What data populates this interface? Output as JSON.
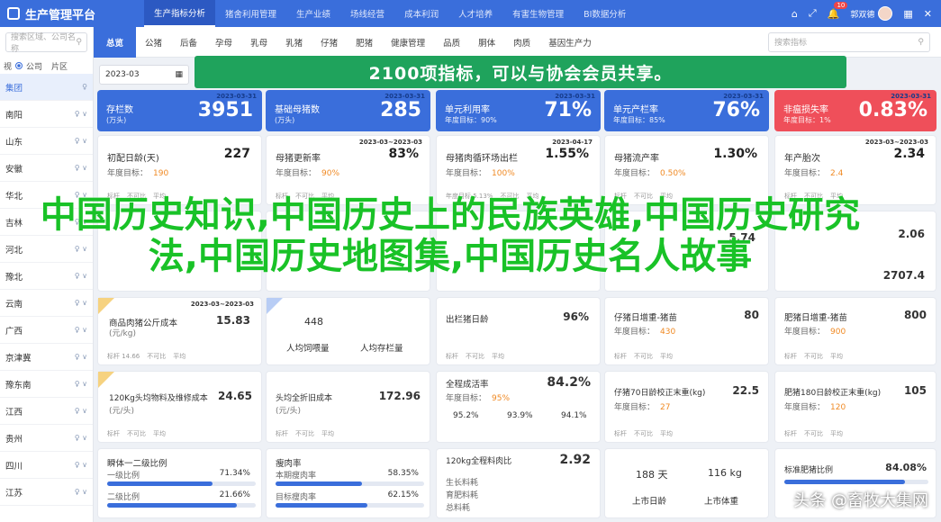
{
  "app": {
    "title": "生产管理平台",
    "user": "郭双德",
    "badge": "10"
  },
  "top_tabs": [
    "生产指标分析",
    "猪舍利用管理",
    "生产业绩",
    "场线经营",
    "成本利润",
    "人才培养",
    "有害生物管理",
    "BI数据分析"
  ],
  "sidebar": {
    "search_placeholder": "搜索区域、公司名称",
    "radio": [
      "公司",
      "片区"
    ],
    "items": [
      "集团",
      "南阳",
      "山东",
      "安徽",
      "华北",
      "吉林",
      "河北",
      "豫北",
      "云南",
      "广西",
      "京津冀",
      "豫东南",
      "江西",
      "贵州",
      "四川",
      "江苏"
    ]
  },
  "sub_tabs": [
    "总览",
    "公猪",
    "后备",
    "孕母",
    "乳母",
    "乳猪",
    "仔猪",
    "肥猪",
    "健康管理",
    "品质",
    "胴体",
    "肉质",
    "基因生产力"
  ],
  "sub_search": "搜索指标",
  "date": "2023-03",
  "banner": "2100项指标，可以与协会会员共享。",
  "kpis": [
    {
      "date": "2023-03-31",
      "title": "存栏数",
      "sub": "(万头)",
      "value": "3951",
      "color": "#3a6edb"
    },
    {
      "date": "2023-03-31",
      "title": "基础母猪数",
      "sub": "(万头)",
      "value": "285",
      "color": "#3a6edb"
    },
    {
      "date": "2023-03-31",
      "title": "单元利用率",
      "sub": "年度目标：90%",
      "value": "71%",
      "color": "#3a6edb"
    },
    {
      "date": "2023-03-31",
      "title": "单元产栏率",
      "sub": "年度目标：85%",
      "value": "76%",
      "color": "#3a6edb"
    },
    {
      "date": "2023-03-31",
      "title": "非瘟损失率",
      "sub": "年度目标：1%",
      "value": "0.83%",
      "color": "#ef4f5a"
    }
  ],
  "row2": [
    {
      "title": "初配日龄(天)",
      "value": "227",
      "goal": "190",
      "date": "",
      "foot": [
        "标杆",
        "不可比",
        "平均"
      ]
    },
    {
      "title": "母猪更新率",
      "value": "83%",
      "goal": "90%",
      "date": "2023-03~2023-03",
      "foot": [
        "标杆",
        "不可比",
        "平均"
      ]
    },
    {
      "title": "母猪肉循环场出栏",
      "value": "1.55%",
      "goal": "100%",
      "date": "2023-04-17",
      "foot": [
        "年度目标 5.13%",
        "不可比",
        "平均"
      ]
    },
    {
      "title": "母猪流产率",
      "value": "1.30%",
      "goal": "0.50%",
      "date": "",
      "foot": [
        "标杆",
        "不可比",
        "平均"
      ]
    },
    {
      "title": "年产胎次",
      "value": "2.34",
      "goal": "2.4",
      "date": "2023-03~2023-03",
      "foot": [
        "标杆",
        "不可比",
        "平均"
      ]
    }
  ],
  "row3": {
    "right1": "5.74",
    "right2": "2.06",
    "right3": "2707.4"
  },
  "row4": [
    {
      "date": "2023-03~2023-03",
      "title": "商品肉猪公斤成本",
      "sub": "(元/kg)",
      "value": "15.83",
      "foot": [
        "标杆 14.66",
        "不可比",
        "平均"
      ]
    },
    {
      "date": "",
      "title": "人均饲喂量",
      "value": "448",
      "title2": "人均存栏量",
      "value2": "",
      "foot": []
    },
    {
      "date": "",
      "title": "出栏猪日龄",
      "value": "96%",
      "foot": [
        "标杆",
        "不可比",
        "平均"
      ]
    },
    {
      "title": "仔猪日增重-猪苗",
      "value": "80",
      "goal": "430",
      "foot": [
        "标杆",
        "不可比",
        "平均"
      ]
    },
    {
      "title": "肥猪日增重-猪苗",
      "value": "800",
      "goal": "900",
      "foot": [
        "标杆",
        "不可比",
        "平均"
      ]
    }
  ],
  "row5": [
    {
      "title": "120Kg头均物料及维修成本",
      "sub": "(元/头)",
      "value": "24.65",
      "foot": [
        "标杆",
        "不可比",
        "平均"
      ]
    },
    {
      "title": "头均全折旧成本",
      "sub": "(元/头)",
      "value": "172.96",
      "foot": [
        "标杆",
        "不可比",
        "平均"
      ]
    },
    {
      "title": "全程成活率",
      "value": "84.2%",
      "goal": "95%",
      "rates": [
        "95.2%",
        "93.9%",
        "94.1%"
      ]
    },
    {
      "title": "仔猪70日龄校正末重(kg)",
      "value": "22.5",
      "goal": "27",
      "foot": [
        "标杆",
        "不可比",
        "平均"
      ]
    },
    {
      "title": "肥猪180日龄校正末重(kg)",
      "value": "105",
      "goal": "120",
      "foot": [
        "标杆",
        "不可比",
        "平均"
      ]
    }
  ],
  "row6": [
    {
      "title": "瞬体一二级比例",
      "l1": "一级比例",
      "v1": "71.34%",
      "l2": "二级比例",
      "v2": "21.66%",
      "p1": 0.71,
      "p2": 0.87
    },
    {
      "title": "瘦肉率",
      "l1": "本期瘦肉率",
      "v1": "58.35%",
      "l2": "目标瘦肉率",
      "v2": "62.15%",
      "p1": 0.58,
      "p2": 0.62
    },
    {
      "title": "120kg全程料肉比",
      "value": "2.92",
      "rows": [
        "生长料耗",
        "育肥料耗",
        "总料耗"
      ]
    },
    {
      "title": "",
      "a": "188 天",
      "b": "116 kg",
      "c": "上市日龄",
      "d": "上市体重"
    },
    {
      "title": "标准肥猪比例",
      "value": "84.08%",
      "p1": 0.84
    }
  ],
  "overlay": "中国历史知识,中国历史上的民族英雄,中国历史研究法,中国历史地图集,中国历史名人故事",
  "watermark": "头条 @畜牧大集网"
}
